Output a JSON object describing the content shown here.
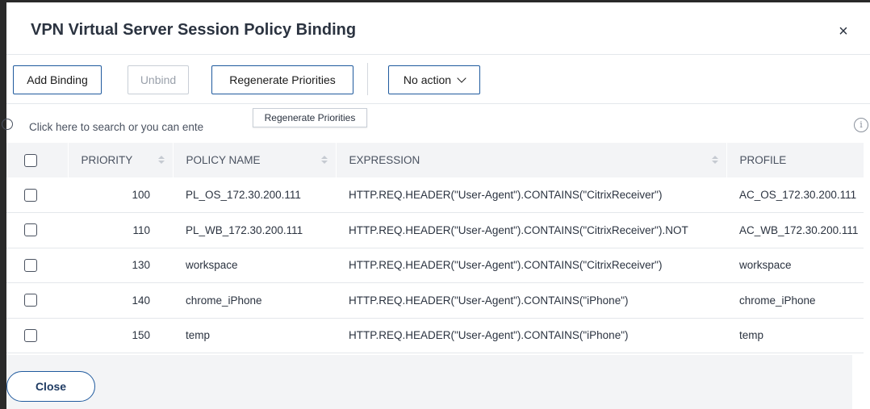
{
  "dialog": {
    "title": "VPN Virtual Server Session Policy Binding",
    "close_glyph": "×"
  },
  "toolbar": {
    "add_binding": "Add Binding",
    "unbind": "Unbind",
    "regenerate": "Regenerate Priorities",
    "action_select": "No action"
  },
  "tooltip": {
    "text": "Regenerate Priorities"
  },
  "search": {
    "placeholder": "Click here to search or you can ente"
  },
  "info_icon": "i",
  "table": {
    "columns": [
      "PRIORITY",
      "POLICY NAME",
      "EXPRESSION",
      "PROFILE"
    ],
    "rows": [
      {
        "priority": "100",
        "policy": "PL_OS_172.30.200.111",
        "expression": "HTTP.REQ.HEADER(\"User-Agent\").CONTAINS(\"CitrixReceiver\")",
        "profile": "AC_OS_172.30.200.111"
      },
      {
        "priority": "110",
        "policy": "PL_WB_172.30.200.111",
        "expression": "HTTP.REQ.HEADER(\"User-Agent\").CONTAINS(\"CitrixReceiver\").NOT",
        "profile": "AC_WB_172.30.200.111"
      },
      {
        "priority": "130",
        "policy": "workspace",
        "expression": "HTTP.REQ.HEADER(\"User-Agent\").CONTAINS(\"CitrixReceiver\")",
        "profile": "workspace"
      },
      {
        "priority": "140",
        "policy": "chrome_iPhone",
        "expression": "HTTP.REQ.HEADER(\"User-Agent\").CONTAINS(\"iPhone\")",
        "profile": "chrome_iPhone"
      },
      {
        "priority": "150",
        "policy": "temp",
        "expression": "HTTP.REQ.HEADER(\"User-Agent\").CONTAINS(\"iPhone\")",
        "profile": "temp"
      }
    ]
  },
  "footer": {
    "close": "Close"
  },
  "colors": {
    "accent": "#1f5a9e",
    "header_bg": "#f3f4f6"
  }
}
